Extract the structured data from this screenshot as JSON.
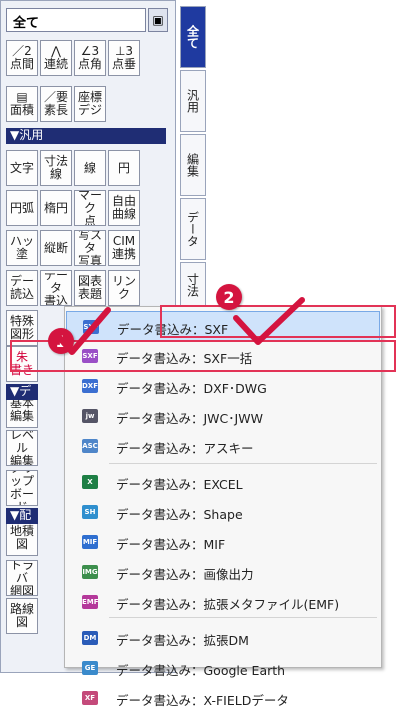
{
  "combo": {
    "value": "全て",
    "button": "▣"
  },
  "toolbar": {
    "row1": [
      "／2\n点間",
      "⋀\n連続",
      "∠3\n点角",
      "⊥3\n点垂"
    ],
    "row2": [
      "▤\n面積",
      "／要\n素長",
      "座標\nデジ"
    ],
    "header_general": "▼汎用",
    "row3": [
      "文字",
      "寸法\n線",
      "線",
      "円"
    ],
    "row4": [
      "円弧",
      "楕円",
      "マーク\n点",
      "自由\n曲線"
    ],
    "row5": [
      "ハッ\n塗",
      "縦断",
      "写スタ\n写真",
      "CIM\n連携"
    ],
    "row6": [
      "デー\n読込",
      "データ\n書込",
      "図表\n表題",
      "リンク"
    ],
    "row7": [
      "特殊\n図形"
    ],
    "row8": [
      "朱\n書き"
    ],
    "header_data": "▼デ",
    "row9": [
      "基本\n編集"
    ],
    "row10": [
      "レベル\n編集"
    ],
    "row11": [
      "クリップ\nボード"
    ],
    "header_layout": "▼配",
    "row12": [
      "地積\n図"
    ],
    "row13": [
      "トラバ\n網図"
    ],
    "row14": [
      "路線\n図"
    ]
  },
  "tabs": [
    "全て",
    "汎用",
    "編集",
    "データ",
    "寸法"
  ],
  "menu": {
    "items": [
      {
        "label": "データ書込み：SXF",
        "icon": "SXF",
        "color": "#3b6fd1"
      },
      {
        "label": "データ書込み：SXF一括",
        "icon": "SXF",
        "color": "#9a4fc6"
      },
      {
        "label": "データ書込み：DXF･DWG",
        "icon": "DXF",
        "color": "#3b6fd1"
      },
      {
        "label": "データ書込み：JWC･JWW",
        "icon": "jw",
        "color": "#556"
      },
      {
        "label": "データ書込み：アスキー",
        "icon": "ASC",
        "color": "#4f86c9"
      },
      {
        "label": "データ書込み：EXCEL",
        "icon": "X",
        "color": "#1e7f45"
      },
      {
        "label": "データ書込み：Shape",
        "icon": "SH",
        "color": "#2f8fce"
      },
      {
        "label": "データ書込み：MIF",
        "icon": "MIF",
        "color": "#2f6fd0"
      },
      {
        "label": "データ書込み：画像出力",
        "icon": "IMG",
        "color": "#3d8f4d"
      },
      {
        "label": "データ書込み：拡張メタファイル(EMF)",
        "icon": "EMF",
        "color": "#b4389a"
      },
      {
        "label": "データ書込み：拡張DM",
        "icon": "DM",
        "color": "#2a5cb8"
      },
      {
        "label": "データ書込み：Google Earth",
        "icon": "GE",
        "color": "#3a8acb"
      },
      {
        "label": "データ書込み：X-FIELDデータ",
        "icon": "XF",
        "color": "#c44a7a"
      }
    ]
  },
  "badges": {
    "one": "1",
    "two": "2"
  }
}
